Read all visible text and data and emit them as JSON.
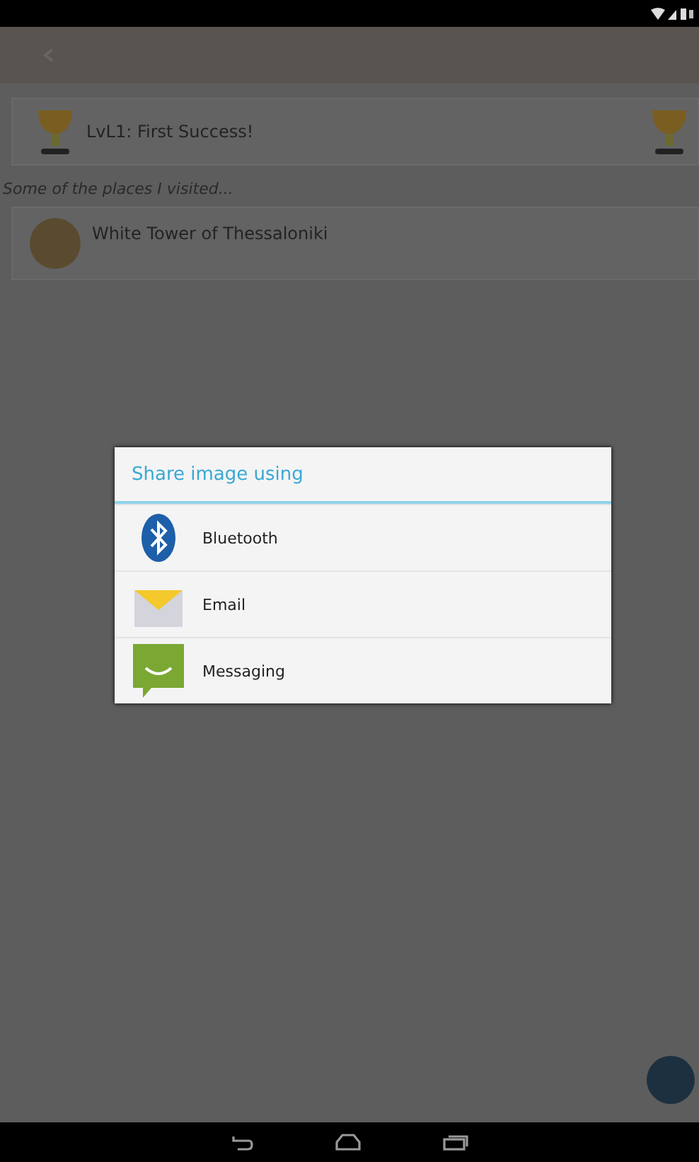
{
  "achievement": {
    "title": "LvL1: First Success!"
  },
  "section_label": "Some of the places I visited...",
  "places": [
    {
      "name": "White Tower of Thessaloniki"
    }
  ],
  "dialog": {
    "title": "Share image using",
    "options": [
      {
        "kind": "bluetooth",
        "label": "Bluetooth"
      },
      {
        "kind": "email",
        "label": "Email"
      },
      {
        "kind": "messaging",
        "label": "Messaging"
      }
    ]
  }
}
